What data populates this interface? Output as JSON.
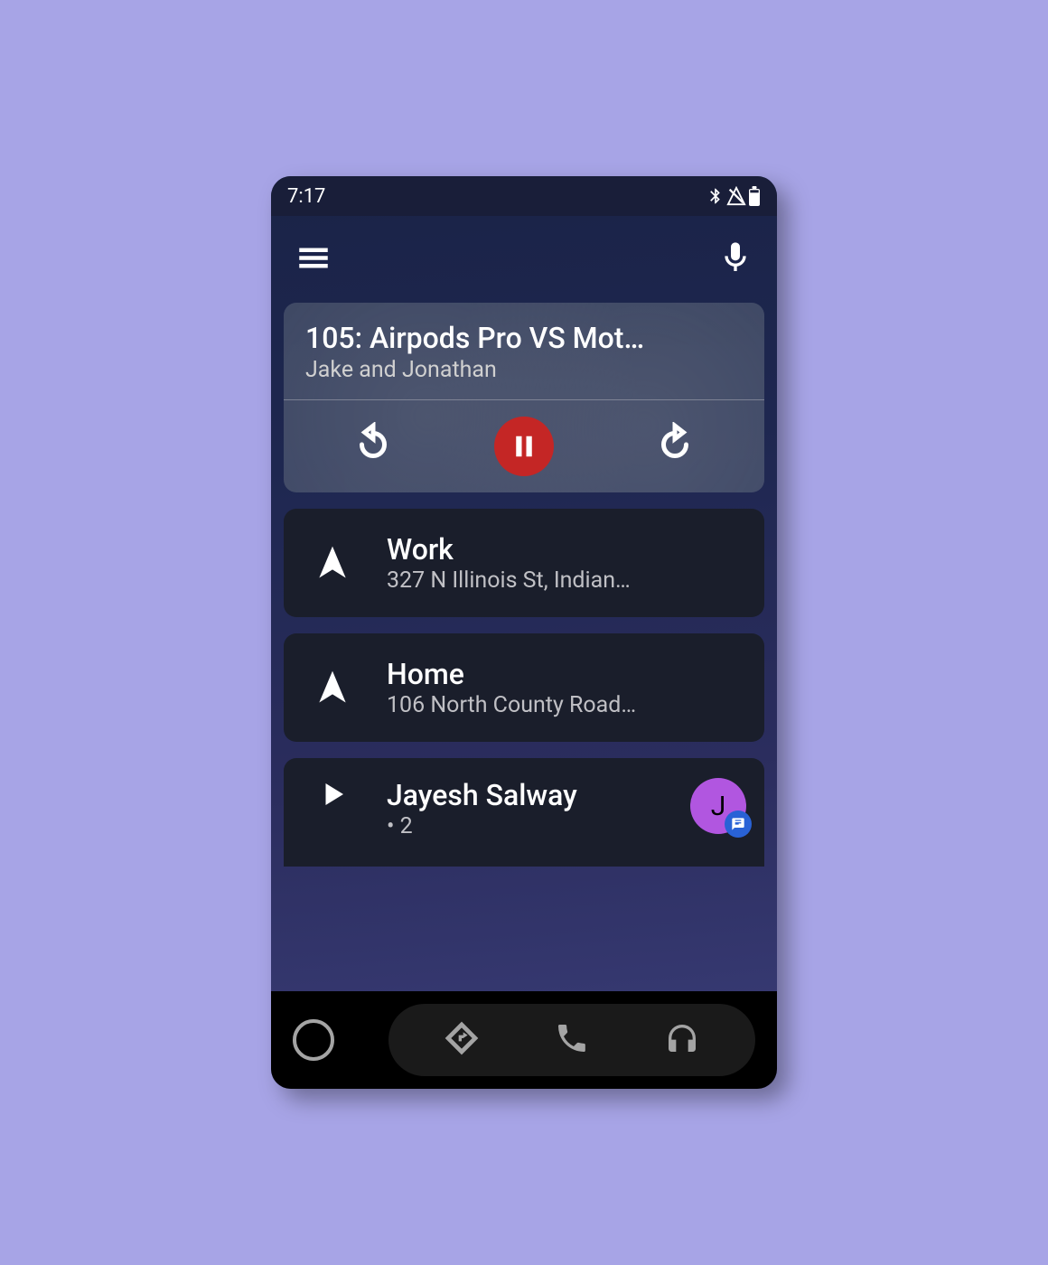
{
  "status": {
    "time": "7:17"
  },
  "media": {
    "title": "105: Airpods Pro VS Mot…",
    "subtitle": "Jake and Jonathan"
  },
  "destinations": [
    {
      "title": "Work",
      "subtitle": "327 N Illinois St, Indian…"
    },
    {
      "title": "Home",
      "subtitle": "106 North County Road…"
    }
  ],
  "message": {
    "sender": "Jayesh Salway",
    "count_line": "• 2",
    "avatar_letter": "J"
  },
  "colors": {
    "accent_red": "#c42625",
    "avatar_purple": "#b156e0",
    "badge_blue": "#2962d6"
  }
}
